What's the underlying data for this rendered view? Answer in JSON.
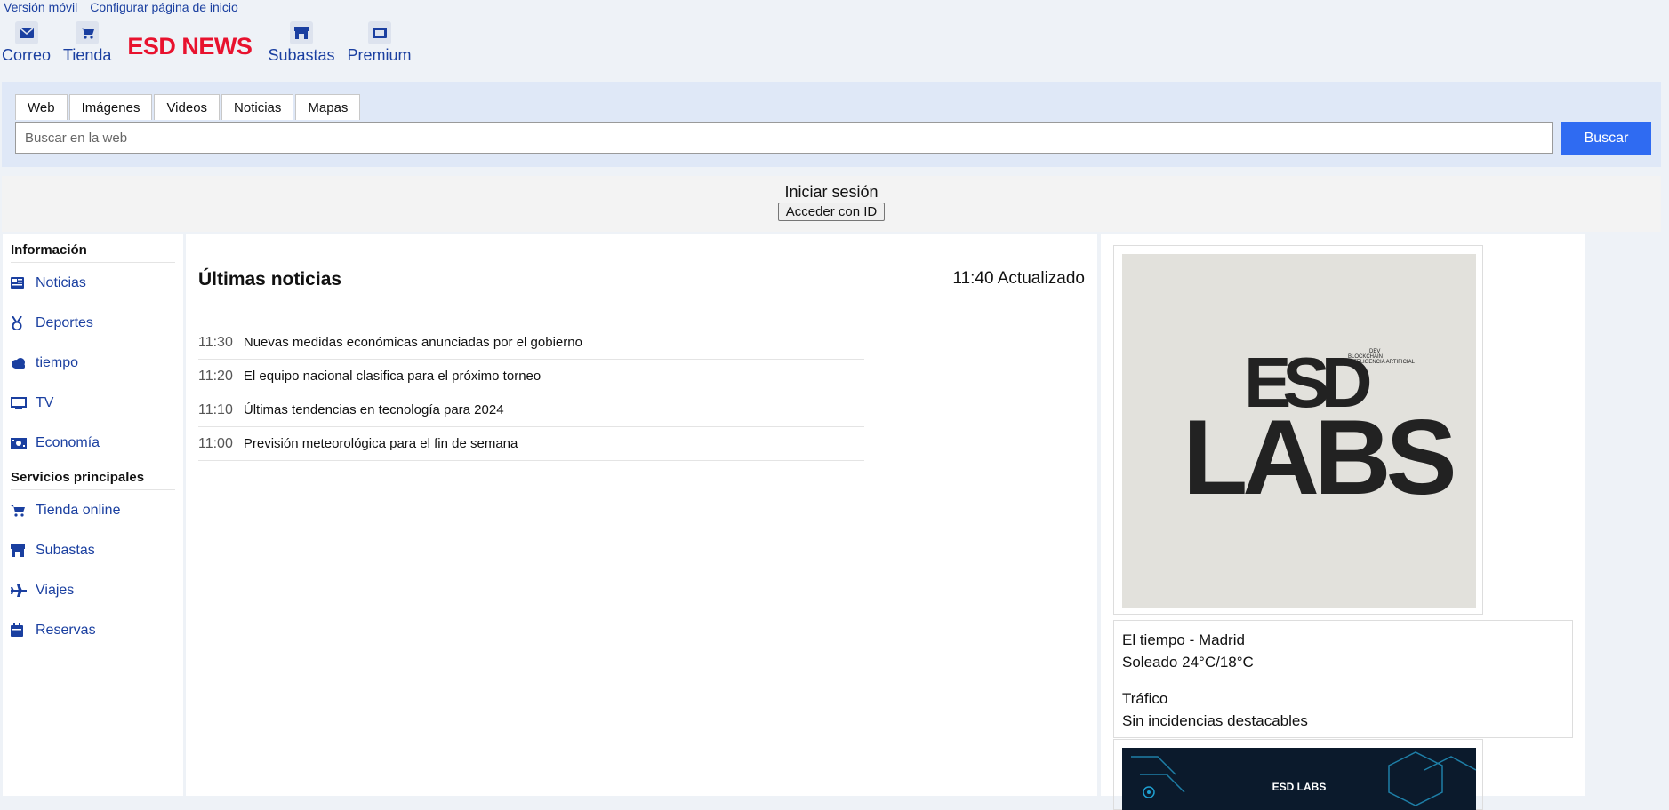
{
  "top_links": {
    "mobile": "Versión móvil",
    "config": "Configurar página de inicio"
  },
  "header": {
    "mail": "Correo",
    "shop": "Tienda",
    "logo": "ESD NEWS",
    "auctions": "Subastas",
    "premium": "Premium"
  },
  "search": {
    "tabs": [
      "Web",
      "Imágenes",
      "Videos",
      "Noticias",
      "Mapas"
    ],
    "placeholder": "Buscar en la web",
    "button": "Buscar"
  },
  "login": {
    "title": "Iniciar sesión",
    "button": "Acceder con ID"
  },
  "sidebar": {
    "info_title": "Información",
    "info_items": [
      {
        "label": "Noticias",
        "icon": "newspaper-icon"
      },
      {
        "label": "Deportes",
        "icon": "medal-icon"
      },
      {
        "label": "tiempo",
        "icon": "cloud-icon"
      },
      {
        "label": "TV",
        "icon": "tv-icon"
      },
      {
        "label": "Economía",
        "icon": "money-icon"
      }
    ],
    "services_title": "Servicios principales",
    "service_items": [
      {
        "label": "Tienda online",
        "icon": "cart-icon"
      },
      {
        "label": "Subastas",
        "icon": "store-icon"
      },
      {
        "label": "Viajes",
        "icon": "plane-icon"
      },
      {
        "label": "Reservas",
        "icon": "calendar-icon"
      }
    ]
  },
  "news": {
    "title": "Últimas noticias",
    "updated": "11:40 Actualizado",
    "items": [
      {
        "time": "11:30",
        "headline": "Nuevas medidas económicas anunciadas por el gobierno"
      },
      {
        "time": "11:20",
        "headline": "El equipo nacional clasifica para el próximo torneo"
      },
      {
        "time": "11:10",
        "headline": "Últimas tendencias en tecnología para 2024"
      },
      {
        "time": "11:00",
        "headline": "Previsión meteorológica para el fin de semana"
      }
    ]
  },
  "ad1": {
    "line_dev": "DEV",
    "line_blockchain": "BLOCKCHAIN",
    "line_ai": "INTELIGENCIA ARTIFICIAL",
    "brand_top": "ESD",
    "brand_bottom": "LABS"
  },
  "weather": {
    "title": "El tiempo - Madrid",
    "value": "Soleado 24°C/18°C"
  },
  "traffic": {
    "title": "Tráfico",
    "value": "Sin incidencias destacables"
  },
  "ad2": {
    "text": "ESD LABS"
  },
  "colors": {
    "accent": "#2f6bf2",
    "logo": "#e8122e",
    "link": "#1a3fa0"
  }
}
